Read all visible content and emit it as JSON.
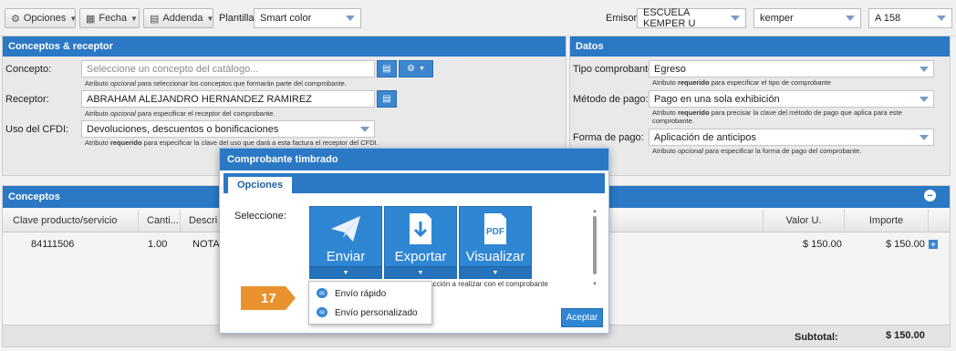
{
  "toolbar": {
    "opciones": "Opciones",
    "fecha": "Fecha",
    "addenda": "Addenda",
    "plantilla_label": "Plantilla:",
    "plantilla_value": "Smart color",
    "emisor_label": "Emisor",
    "emisor_value": "ESCUELA KEMPER U",
    "user_value": "kemper",
    "serie_value": "A 158"
  },
  "conceptos_receptor": {
    "title": "Conceptos & receptor",
    "concepto_label": "Concepto:",
    "concepto_placeholder": "Seleccione un concepto del catálogo...",
    "concepto_hint_a": "Atributo ",
    "concepto_hint_b": "opcional",
    "concepto_hint_c": " para seleccionar los conceptos que formarán parte del comprobante.",
    "receptor_label": "Receptor:",
    "receptor_value": "ABRAHAM ALEJANDRO HERNANDEZ RAMIREZ",
    "receptor_hint_a": "Atributo ",
    "receptor_hint_b": "opcional",
    "receptor_hint_c": " para especificar el receptor del comprobante.",
    "cfdi_label": "Uso del CFDI:",
    "cfdi_value": "Devoluciones, descuentos o bonificaciones",
    "cfdi_hint_a": "Atributo ",
    "cfdi_hint_b": "requerido",
    "cfdi_hint_c": " para especificar la clave del uso que dará a esta factura el receptor del CFDI."
  },
  "datos": {
    "title": "Datos",
    "tipo_label": "Tipo comprobante:",
    "tipo_value": "Egreso",
    "tipo_hint_a": "Atributo ",
    "tipo_hint_b": "requerido",
    "tipo_hint_c": " para especificar el tipo de comprobante",
    "metodo_label": "Método de pago:",
    "metodo_value": "Pago en una sola exhibición",
    "metodo_hint_a": "Atributo ",
    "metodo_hint_b": "requerido",
    "metodo_hint_c": " para precisar la clave del método de pago que aplica para este comprobante.",
    "forma_label": "Forma de pago:",
    "forma_value": "Aplicación de anticipos",
    "forma_hint_a": "Atributo ",
    "forma_hint_b": "opcional",
    "forma_hint_c": " para especificar la forma de pago del comprobante."
  },
  "conceptos": {
    "title": "Conceptos",
    "headers": [
      "Clave producto/servicio",
      "Canti...",
      "Descri",
      "Valor U.",
      "Importe"
    ],
    "rows": [
      {
        "clave": "84111506",
        "cantidad": "1.00",
        "descripcion": "NOTA",
        "valor": "$ 150.00",
        "importe": "$ 150.00"
      }
    ],
    "subtotal_label": "Subtotal:",
    "subtotal_value": "$ 150.00"
  },
  "modal": {
    "title": "Comprobante timbrado",
    "tab": "Opciones",
    "seleccione": "Seleccione:",
    "buttons": [
      "Enviar",
      "Exportar",
      "Visualizar"
    ],
    "hint": "Atributo opcional para seleccionar la acción a realizar con el comprobante",
    "menu_items": [
      "Envío rápido",
      "Envío personalizado"
    ],
    "accept": "Aceptar",
    "step_badge": "17"
  },
  "colors": {
    "accent": "#2b78c5",
    "badge": "#e8922e"
  }
}
